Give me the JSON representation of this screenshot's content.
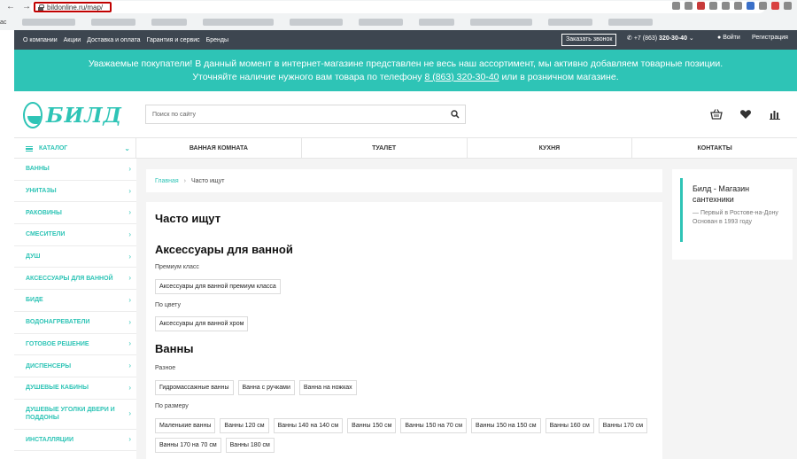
{
  "browser": {
    "url": "bildonline.ru/map/",
    "bookmark_first": "ac"
  },
  "topbar": {
    "links": [
      "О компании",
      "Акции",
      "Доставка и оплата",
      "Гарантия и сервис",
      "Бренды"
    ],
    "callback": "Заказать звонок",
    "phone_prefix": "+7 (863)",
    "phone_number": "320-30-40",
    "login": "Войти",
    "register": "Регистрация"
  },
  "notice": {
    "line1": "Уважаемые покупатели! В данный момент в интернет-магазине представлен не весь наш ассортимент, мы активно добавляем товарные позиции.",
    "line2_before": "Уточняйте наличие нужного вам товара по телефону",
    "line2_phone": "8 (863) 320-30-40",
    "line2_after": "или в розничном магазине."
  },
  "header": {
    "logo_text": "БИЛД",
    "search_placeholder": "Поиск по сайту"
  },
  "catalog": {
    "label": "КАТАЛОГ",
    "top_categories": [
      "ВАННАЯ КОМНАТА",
      "ТУАЛЕТ",
      "КУХНЯ",
      "КОНТАКТЫ"
    ],
    "sidebar_items": [
      "ВАННЫ",
      "УНИТАЗЫ",
      "РАКОВИНЫ",
      "СМЕСИТЕЛИ",
      "ДУШ",
      "АКСЕССУАРЫ ДЛЯ ВАННОЙ",
      "БИДЕ",
      "ВОДОНАГРЕВАТЕЛИ",
      "ГОТОВОЕ РЕШЕНИЕ",
      "ДИСПЕНСЕРЫ",
      "ДУШЕВЫЕ КАБИНЫ",
      "ДУШЕВЫЕ УГОЛКИ ДВЕРИ И ПОДДОНЫ",
      "ИНСТАЛЛЯЦИИ"
    ]
  },
  "breadcrumb": {
    "home": "Главная",
    "separator": "›",
    "current": "Часто ищут"
  },
  "content": {
    "title": "Часто ищут",
    "sections": [
      {
        "heading": "Аксессуары для ванной",
        "groups": [
          {
            "label": "Премиум класс",
            "tags": [
              "Аксессуары для ванной премиум класса"
            ]
          },
          {
            "label": "По цвету",
            "tags": [
              "Аксессуары для ванной хром"
            ]
          }
        ]
      },
      {
        "heading": "Ванны",
        "groups": [
          {
            "label": "Разное",
            "tags": [
              "Гидромассажные ванны",
              "Ванна с ручками",
              "Ванна на ножках"
            ]
          },
          {
            "label": "По размеру",
            "tags": [
              "Маленькие ванны",
              "Ванны 120 см",
              "Ванны 140 на 140 см",
              "Ванны 150 см",
              "Ванны 150 на 70 см",
              "Ванны 150 на 150 см",
              "Ванны 160 см",
              "Ванны 170 см",
              "Ванны 170 на 70 см",
              "Ванны 180 см"
            ]
          }
        ]
      }
    ]
  },
  "info_card": {
    "title": "Билд - Магазин сантехники",
    "desc": "— Первый в Ростове-на-Дону Основан в 1993 году"
  },
  "colors": {
    "accent": "#2ec4b6",
    "topbar": "#3d4650",
    "url_highlight": "#c00000"
  },
  "icons": [
    "back-icon",
    "forward-icon",
    "reload-icon",
    "home-icon",
    "lock-icon",
    "chevron-down-icon",
    "phone-icon",
    "user-icon",
    "search-icon",
    "basket-icon",
    "heart-icon",
    "compare-icon",
    "burger-icon",
    "chevron-right-icon"
  ]
}
